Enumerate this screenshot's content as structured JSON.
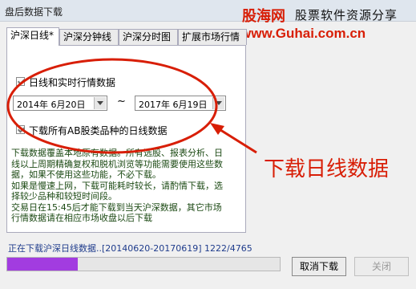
{
  "window": {
    "title": "盘后数据下载"
  },
  "watermark": {
    "site_cn": "股海网",
    "slogan": "股票软件资源分享",
    "url": "www.Guhai.com.cn"
  },
  "tabs": [
    {
      "label": "沪深日线*",
      "active": true
    },
    {
      "label": "沪深分钟线",
      "active": false
    },
    {
      "label": "沪深分时图",
      "active": false
    },
    {
      "label": "扩展市场行情",
      "active": false
    }
  ],
  "daily": {
    "checkbox_label": "日线和实时行情数据",
    "checked": true,
    "start_date": "2014年  6月20日",
    "end_date": "2017年  6月19日",
    "range_separator": "~",
    "ab_checkbox_label": "下载所有AB股类品种的日线数据",
    "ab_checked": true
  },
  "info_lines": [
    "    下载数据覆盖本地原有数据。所有选股、报表分析、日线以上周期精确复权和脱机浏览等功能需要使用这些数据，如果不使用这些功能，不必下载。",
    "    如果是慢速上网，下载可能耗时较长，请酌情下载，选择较少品种和较短时间段。",
    "    交易日在15:45后才能下载到当天沪深数据，其它市场行情数据请在相应市场收盘以后下载"
  ],
  "annotation": {
    "text": "下载日线数据",
    "color": "#d81e06"
  },
  "status": {
    "text": "正在下载沪深日线数据..[20140620-20170619] 1222/4765"
  },
  "progress": {
    "value": 0.26
  },
  "buttons": {
    "cancel_label": "取消下载",
    "close_label": "关闭",
    "close_disabled": true
  }
}
